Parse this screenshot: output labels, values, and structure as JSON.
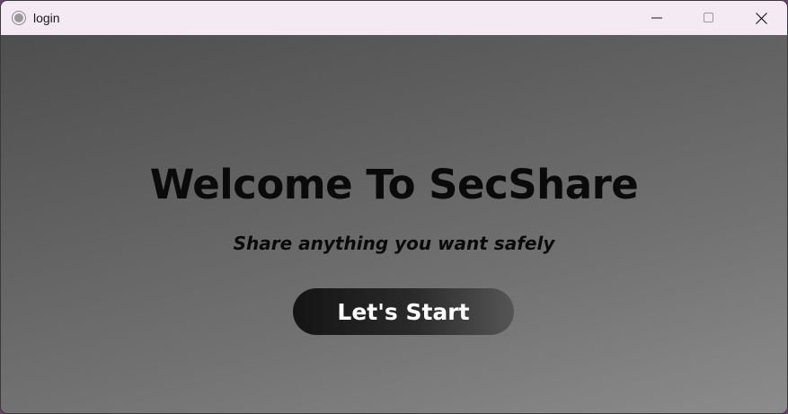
{
  "window": {
    "title": "login",
    "icon": "app-circle-icon",
    "controls": {
      "minimize_icon": "minimize-icon",
      "maximize_icon": "maximize-icon",
      "close_icon": "close-icon"
    }
  },
  "main": {
    "heading": "Welcome To SecShare",
    "tagline": "Share anything you want safely",
    "start_button_label": "Let's Start"
  },
  "colors": {
    "titlebar": "#f4eaf3",
    "background_top": "#4e4e4e",
    "background_bottom": "#8c8c8c",
    "button_start": "#141414",
    "button_end": "#555555",
    "heading_text": "#0a0a0a",
    "button_text": "#ffffff"
  }
}
